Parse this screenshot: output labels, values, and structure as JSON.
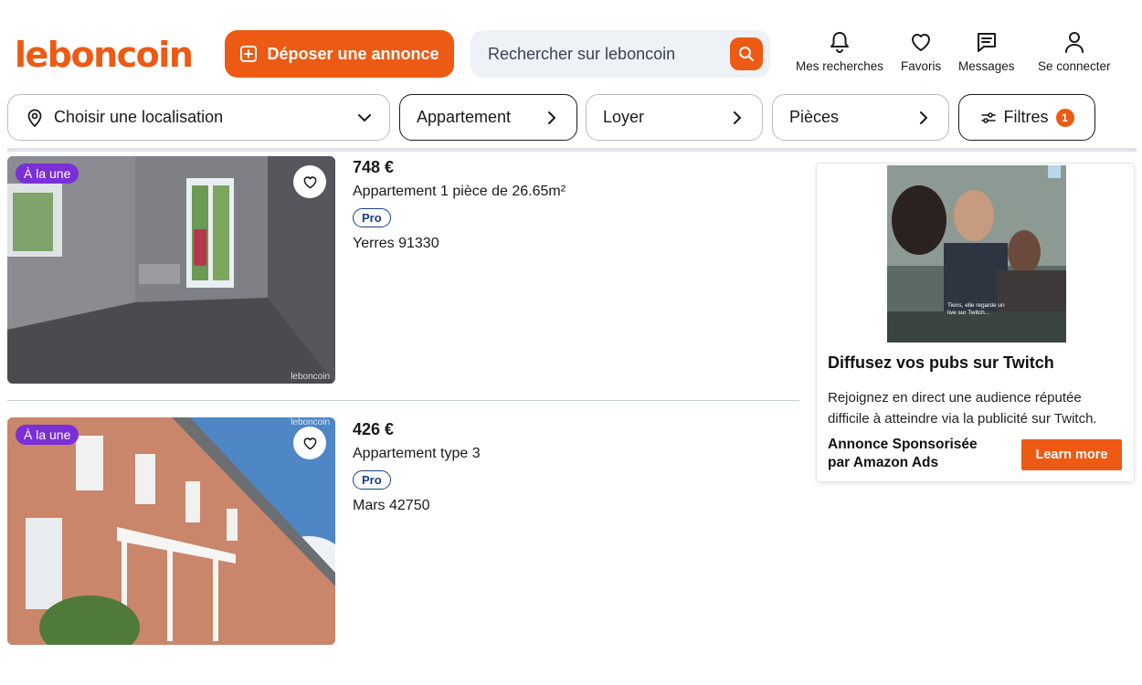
{
  "header": {
    "logo": "leboncoin",
    "deposit_label": "Déposer une annonce",
    "search_placeholder": "Rechercher sur leboncoin",
    "nav": {
      "searches": "Mes recherches",
      "favorites": "Favoris",
      "messages": "Messages",
      "login": "Se connecter"
    }
  },
  "filters": {
    "location": "Choisir une localisation",
    "category": "Appartement",
    "rent": "Loyer",
    "rooms": "Pièces",
    "more": "Filtres",
    "more_count": "1"
  },
  "listings": [
    {
      "tag": "À la une",
      "price": "748 €",
      "title": "Appartement 1 pièce de 26.65m²",
      "badge": "Pro",
      "location": "Yerres 91330",
      "watermark": "leboncoin"
    },
    {
      "tag": "À la une",
      "price": "426 €",
      "title": "Appartement type 3",
      "badge": "Pro",
      "location": "Mars 42750",
      "watermark": "leboncoin"
    }
  ],
  "ad": {
    "video_caption": "Tiens, elle regarde un live sur Twitch...",
    "title": "Diffusez vos pubs sur Twitch",
    "description": "Rejoignez en direct une audience réputée difficile à atteindre via la publicité sur Twitch.",
    "sponsor": "Annonce Sponsorisée par Amazon Ads",
    "cta": "Learn more"
  },
  "colors": {
    "brand": "#ec5a13",
    "tag": "#7b2fd6",
    "pro": "#164081"
  }
}
